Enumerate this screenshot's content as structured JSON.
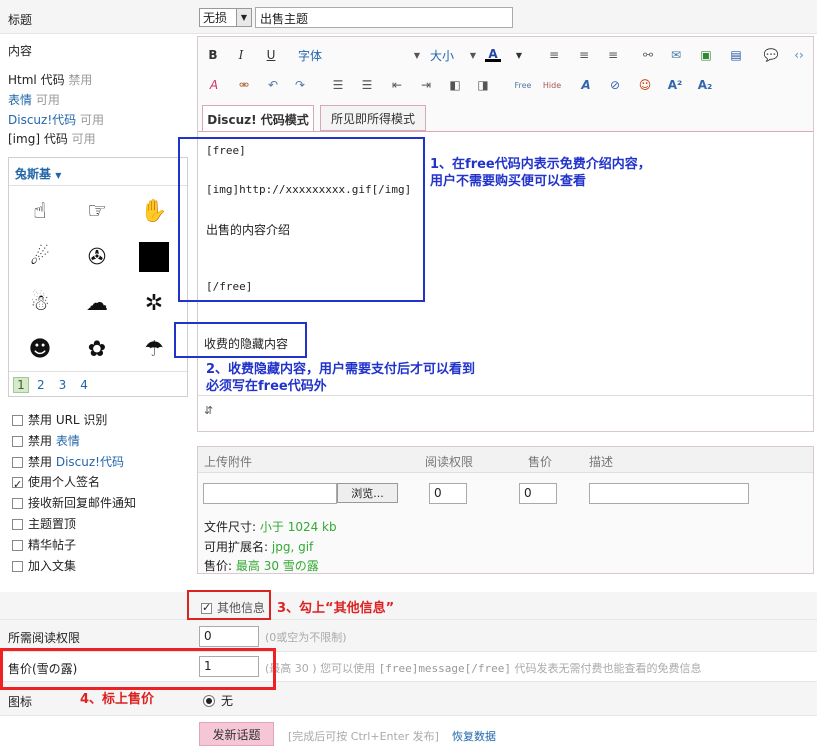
{
  "title_row": {
    "label": "标题",
    "type_select": "无损",
    "subject": "出售主题"
  },
  "content_label": "内容",
  "code_help": [
    {
      "name": "Html 代码",
      "status": "禁用"
    },
    {
      "name": "表情",
      "status": "可用"
    },
    {
      "name": "Discuz!代码",
      "status": "可用"
    },
    {
      "name": "[img] 代码",
      "status": "可用"
    }
  ],
  "toolbar": {
    "font": "字体",
    "size": "大小"
  },
  "editor_tabs": [
    "Discuz! 代码模式",
    "所见即所得模式"
  ],
  "editor_lines": [
    "[free]",
    "[img]http://xxxxxxxxx.gif[/img]",
    "出售的内容介绍",
    "[/free]",
    "收费的隐藏内容"
  ],
  "smiley_panel": {
    "title": "兔斯基",
    "pages": [
      "1",
      "2",
      "3",
      "4"
    ],
    "current_page": "1"
  },
  "options": [
    {
      "label": "禁用 URL 识别",
      "checked": false
    },
    {
      "label": "禁用",
      "link": "表情",
      "checked": false
    },
    {
      "label": "禁用",
      "link": "Discuz!代码",
      "checked": false
    },
    {
      "label": "使用个人签名",
      "checked": true
    },
    {
      "label": "接收新回复邮件通知",
      "checked": false
    },
    {
      "label": "主题置顶",
      "checked": false
    },
    {
      "label": "精华帖子",
      "checked": false
    },
    {
      "label": "加入文集",
      "checked": false
    }
  ],
  "attach": {
    "headers": [
      "上传附件",
      "阅读权限",
      "售价",
      "描述"
    ],
    "browse": "浏览...",
    "read_perm": "0",
    "price": "0",
    "size_label": "文件尺寸:",
    "size_value": "小于 1024 kb",
    "ext_label": "可用扩展名:",
    "ext_value": "jpg, gif",
    "price_label": "售价:",
    "price_value": "最高 30 雪の露"
  },
  "other_info": {
    "label": "其他信息",
    "checked": true
  },
  "read_perm_row": {
    "label": "所需阅读权限",
    "value": "0",
    "hint": "(0或空为不限制)"
  },
  "price_row": {
    "label": "售价(雪の露)",
    "value": "1",
    "hint_a": "(最高 30 ) 您可以使用",
    "hint_code": "[free]message[/free]",
    "hint_b": "代码发表无需付费也能查看的免费信息"
  },
  "icon_row": {
    "label": "图标",
    "option": "无"
  },
  "submit": {
    "button": "发新话题",
    "hint": "[完成后可按 Ctrl+Enter 发布]",
    "restore": "恢复数据"
  },
  "annotations": {
    "a1": "1、在free代码内表示免费介绍内容，用户不需要购买便可以查看",
    "a1_l1": "1、在free代码内表示免费介绍内容，",
    "a1_l2": "用户不需要购买便可以查看",
    "a2_l1": "2、收费隐藏内容，用户需要支付后才可以看到",
    "a2_l2": "必须写在free代码外",
    "a3": "3、勾上“其他信息”",
    "a4": "4、标上售价"
  },
  "colors": {
    "annot_blue": "#2233cc",
    "annot_red": "#dd2222",
    "submit_bg": "#f4c6d6"
  }
}
